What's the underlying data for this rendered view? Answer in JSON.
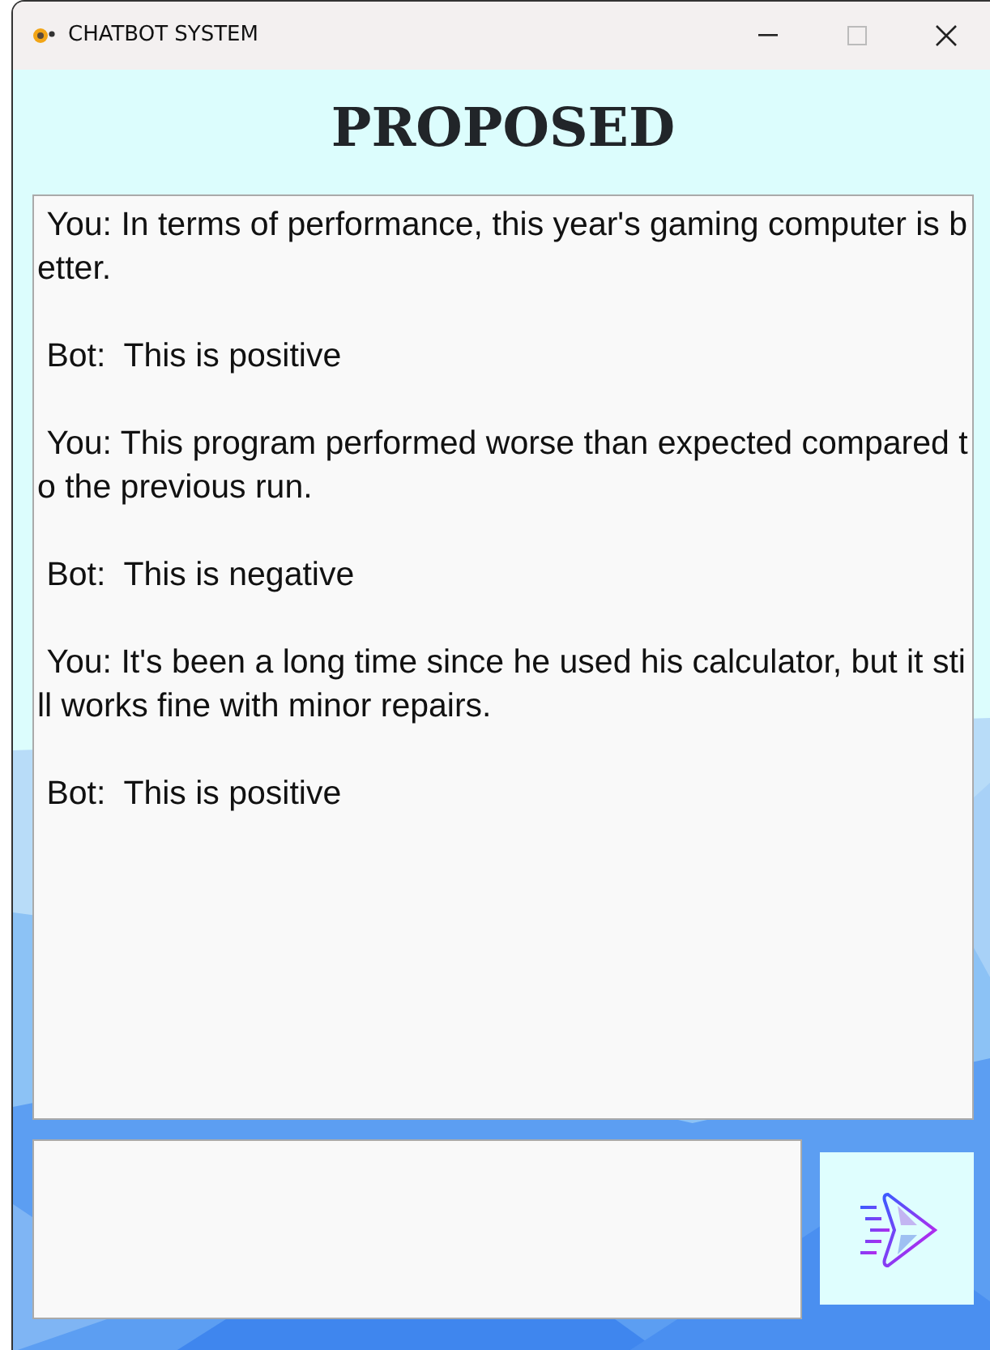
{
  "window": {
    "title": "CHATBOT SYSTEM"
  },
  "heading": "PROPOSED",
  "messages": [
    {
      "text": "You: In terms of performance, this year's gaming computer is better."
    },
    {
      "text": "Bot:  This is positive"
    },
    {
      "text": "You: This program performed worse than expected compared to the previous run."
    },
    {
      "text": "Bot:  This is negative"
    },
    {
      "text": "You: It's been a long time since he used his calculator, but it still works fine with minor repairs."
    },
    {
      "text": "Bot:  This is positive"
    }
  ]
}
